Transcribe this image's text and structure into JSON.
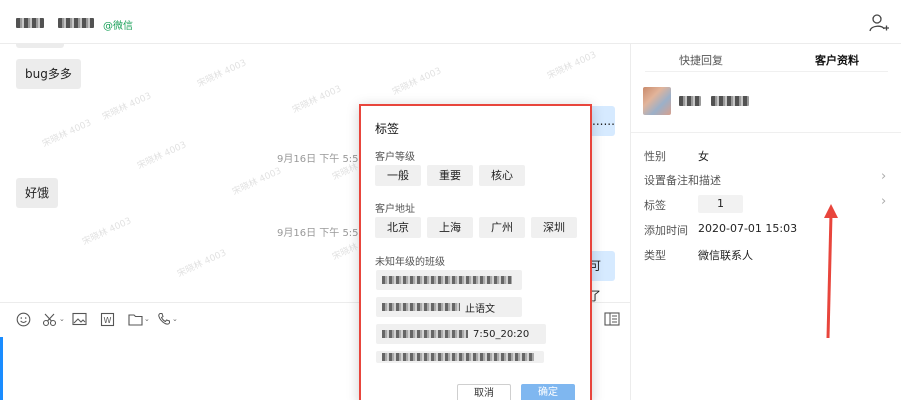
{
  "header": {
    "contact_tag": "@微信",
    "add_user_icon": "add-user-icon"
  },
  "chat": {
    "watermark_text": "宋晓林 4003",
    "messages": [
      {
        "side": "left",
        "text": "bug多多"
      },
      {
        "side": "right",
        "text": "......"
      },
      {
        "side": "time",
        "text": "9月16日 下午 5:53"
      },
      {
        "side": "left",
        "text": "好饿"
      },
      {
        "side": "time",
        "text": "9月16日 下午 5:59"
      },
      {
        "side": "right",
        "text": "可了"
      }
    ]
  },
  "toolbar": {
    "icons": [
      "emoji-icon",
      "scissors-icon",
      "image-icon",
      "word-file-icon",
      "folder-icon",
      "phone-icon",
      "sidebar-toggle-icon"
    ],
    "word_letter": "W"
  },
  "panel": {
    "tabs": [
      "快捷回复",
      "客户资料"
    ],
    "active_tab": "客户资料",
    "fields": {
      "gender_label": "性别",
      "gender_value": "女",
      "remark_label": "设置备注和描述",
      "tag_label": "标签",
      "tag_value": "1",
      "added_label": "添加时间",
      "added_value": "2020-07-01 15:03",
      "type_label": "类型",
      "type_value": "微信联系人"
    }
  },
  "dialog": {
    "title": "标签",
    "groups": [
      {
        "label": "客户等级",
        "tags": [
          "一般",
          "重要",
          "核心"
        ]
      },
      {
        "label": "客户地址",
        "tags": [
          "北京",
          "上海",
          "广州",
          "深圳"
        ]
      },
      {
        "label": "未知年级的班级",
        "rows": [
          "",
          "止语文",
          "7:50_20:20",
          ""
        ]
      }
    ],
    "cancel_label": "取消",
    "ok_label": "确定"
  },
  "colors": {
    "accent_blue": "#1a8cff",
    "annotation_red": "#e8453c",
    "wechat_green": "#18a058",
    "bubble_right": "#d6eaff",
    "bubble_left": "#ececec"
  }
}
